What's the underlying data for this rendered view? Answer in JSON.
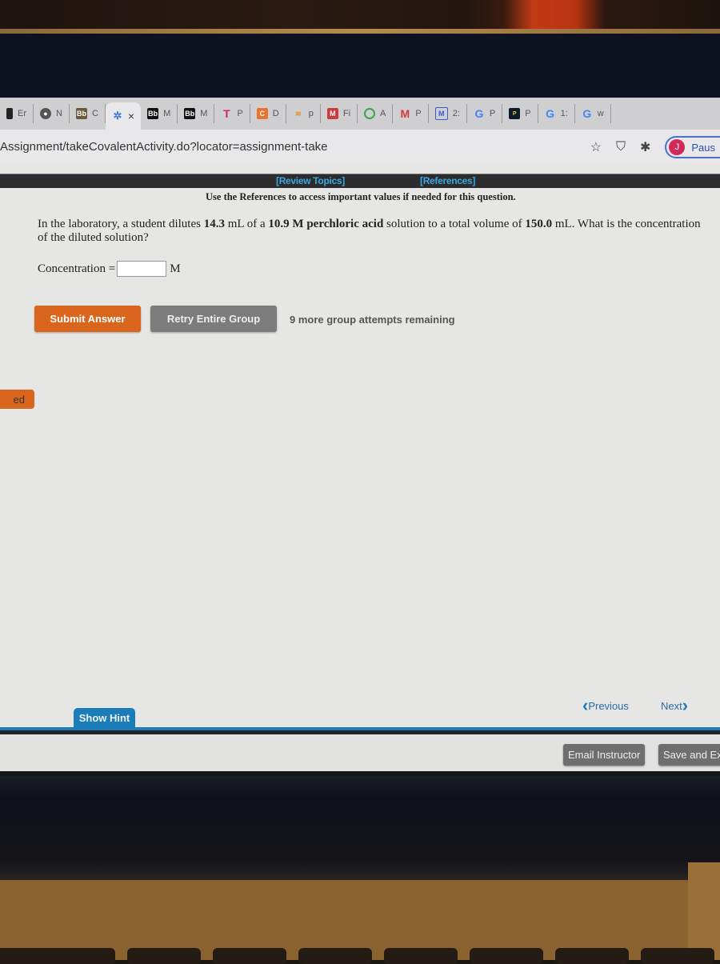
{
  "browser": {
    "tabs": [
      {
        "icon": "bb-icon",
        "label": "Er"
      },
      {
        "icon": "globe-icon",
        "label": "N"
      },
      {
        "icon": "bb-icon",
        "label": "C"
      },
      {
        "icon": "loading-spinner-icon",
        "label": "×",
        "active": true
      },
      {
        "icon": "bb-icon",
        "label": "M"
      },
      {
        "icon": "bb-icon",
        "label": "M"
      },
      {
        "icon": "t-logo-icon",
        "label": "P"
      },
      {
        "icon": "c-logo-icon",
        "label": "D"
      },
      {
        "icon": "stack-icon",
        "label": "p"
      },
      {
        "icon": "m-logo-icon",
        "label": "Fi"
      },
      {
        "icon": "circle-icon",
        "label": "A"
      },
      {
        "icon": "gmail-icon",
        "label": "P"
      },
      {
        "icon": "m-logo-icon",
        "label": "2:"
      },
      {
        "icon": "google-icon",
        "label": "P"
      },
      {
        "icon": "pdf-icon",
        "label": "P"
      },
      {
        "icon": "google-icon",
        "label": "1:"
      },
      {
        "icon": "google-icon",
        "label": "w"
      }
    ],
    "url": "Assignment/takeCovalentActivity.do?locator=assignment-take",
    "profile_initial": "J",
    "profile_label": "Paus"
  },
  "assignment": {
    "review_topics": "[Review Topics]",
    "references": "[References]",
    "notice": "Use the References to access important values if needed for this question.",
    "question": {
      "part1": "In the laboratory, a student dilutes ",
      "volume_initial": "14.3",
      "part2": " mL of a ",
      "molarity": "10.9 M perchloric acid",
      "part3": " solution to a total volume of ",
      "volume_final": "150.0",
      "part4": " mL. What is the concentration of the diluted solution?"
    },
    "answer_label": "Concentration =",
    "answer_value": "",
    "answer_unit": "M",
    "submit_label": "Submit Answer",
    "retry_label": "Retry Entire Group",
    "attempts_text": "9 more group attempts remaining",
    "side_tab_label": "ed",
    "hint_label": "Show Hint",
    "previous_label": "Previous",
    "next_label": "Next"
  },
  "footer": {
    "email_label": "Email Instructor",
    "save_label": "Save and Ex"
  },
  "colors": {
    "submit": "#d9661c",
    "retry": "#7c7c7c",
    "hint": "#1a7db9",
    "link": "#3aa9e0"
  }
}
